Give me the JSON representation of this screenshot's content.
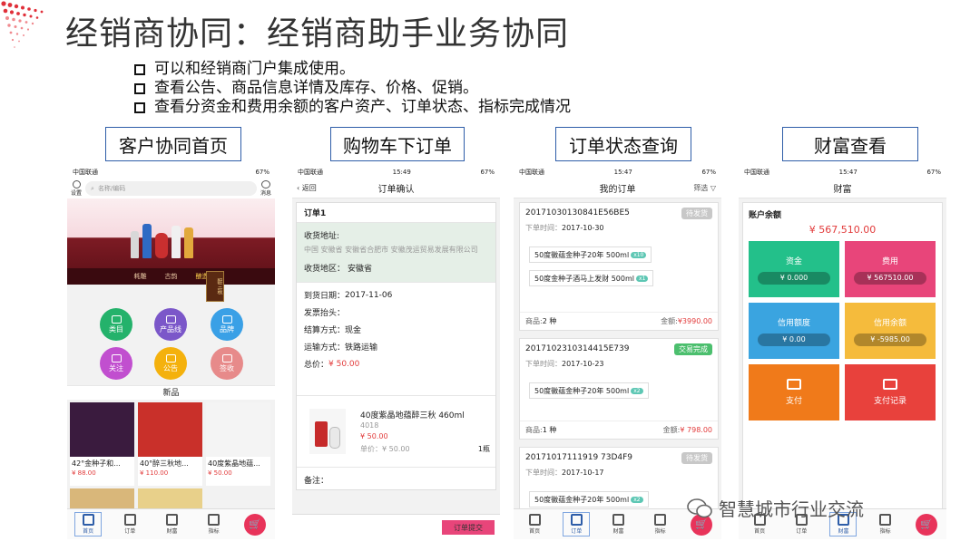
{
  "title": "经销商协同：经销商助手业务协同",
  "bullets": [
    "可以和经销商门户集成使用。",
    "查看公告、商品信息详情及库存、价格、促销。",
    "查看分资金和费用余额的客户资产、订单状态、指标完成情况"
  ],
  "sections": [
    "客户协同首页",
    "购物车下订单",
    "订单状态查询",
    "财富查看"
  ],
  "status_bar": {
    "carrier": "中国联通",
    "battery": "67%",
    "times": [
      "15:49",
      "15:47",
      "15:47"
    ]
  },
  "tabs": [
    {
      "label": "首页",
      "icon": "home-icon"
    },
    {
      "label": "订单",
      "icon": "order-icon"
    },
    {
      "label": "财富",
      "icon": "wealth-icon"
    },
    {
      "label": "指标",
      "icon": "indicator-icon"
    }
  ],
  "home": {
    "nav_left": "设置",
    "nav_right": "消息",
    "search_placeholder": "名称/编码",
    "banner_tabs": [
      "耗雕",
      "古韵",
      "酿造"
    ],
    "banner_caption": "醉三秋",
    "menu": [
      {
        "label": "类目",
        "color": "#24b26b"
      },
      {
        "label": "产品线",
        "color": "#7b57c9"
      },
      {
        "label": "品牌",
        "color": "#3aa0e6"
      },
      {
        "label": "关注",
        "color": "#c14fcf"
      },
      {
        "label": "公告",
        "color": "#f4b10d"
      },
      {
        "label": "签收",
        "color": "#e78a8a"
      }
    ],
    "new_label": "新品",
    "products": [
      {
        "name": "42°金种子和...",
        "price": "¥ 88.00"
      },
      {
        "name": "40°醉三秋地...",
        "price": "¥ 110.00"
      },
      {
        "name": "40度紫晶地蕴...",
        "price": "¥ 50.00"
      }
    ]
  },
  "confirm": {
    "back": "返回",
    "title": "订单确认",
    "order_label": "订单1",
    "addr_label": "收货地址:",
    "addr_value": "中国 安徽省 安徽省合肥市 安徽茂运贸易发展有限公司",
    "region_label": "收货地区：",
    "region_value": "安徽省",
    "date_label": "到货日期：",
    "date_value": "2017-11-06",
    "invoice_label": "发票抬头：",
    "settle_label": "结算方式：",
    "settle_value": "现金",
    "ship_label": "运输方式：",
    "ship_value": "铁路运输",
    "total_label": "总价：",
    "total_value": "¥ 50.00",
    "product_name": "40度紫晶地蕴醉三秋 460ml",
    "product_code": "4018",
    "product_price": "¥ 50.00",
    "unit_label": "单价：",
    "unit_value": "¥ 50.00",
    "qty": "1瓶",
    "remark_label": "备注：",
    "submit": "订单提交"
  },
  "orders": {
    "title": "我的订单",
    "filter": "筛选",
    "time_label": "下单时间：",
    "count_prefix": "商品:",
    "amount_prefix": "金额:",
    "list": [
      {
        "no": "20171030130841E56BE5",
        "status": "待发货",
        "status_color": "#c8c8c8",
        "time": "2017-10-30",
        "items": [
          {
            "name": "50度徽蕴金种子20年 500ml",
            "qty": "x10"
          },
          {
            "name": "50度金种子酒马上发财 500ml",
            "qty": "x1"
          }
        ],
        "count": "2 种",
        "amount": "¥3990.00"
      },
      {
        "no": "2017102310314415E739",
        "status": "交易完成",
        "status_color": "#4cbf6e",
        "time": "2017-10-23",
        "items": [
          {
            "name": "50度徽蕴金种子20年 500ml",
            "qty": "x2"
          }
        ],
        "count": "1 种",
        "amount": "¥ 798.00"
      },
      {
        "no": "20171017111919 73D4F9",
        "status": "待发货",
        "status_color": "#c8c8c8",
        "time": "2017-10-17",
        "items": [
          {
            "name": "50度徽蕴金种子20年 500ml",
            "qty": "x2"
          }
        ],
        "count": "",
        "amount": ""
      }
    ]
  },
  "wealth": {
    "title": "财富",
    "balance_label": "账户余额",
    "balance_value": "¥ 567,510.00",
    "tiles": [
      {
        "label": "资金",
        "value": "¥ 0.000",
        "color": "#23c08a"
      },
      {
        "label": "费用",
        "value": "¥ 567510.00",
        "color": "#e8457a"
      },
      {
        "label": "信用额度",
        "value": "¥ 0.00",
        "color": "#3aa4e0"
      },
      {
        "label": "信用余额",
        "value": "¥ -5985.00",
        "color": "#f5bb3c"
      },
      {
        "label": "支付",
        "color": "#f07a1a"
      },
      {
        "label": "支付记录",
        "color": "#e8413c"
      }
    ]
  },
  "watermark": "智慧城市行业交流"
}
